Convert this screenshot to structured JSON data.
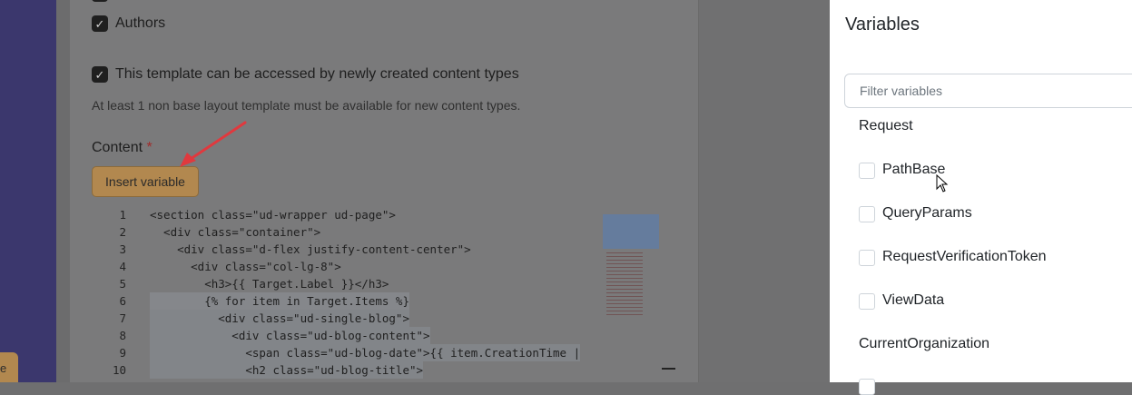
{
  "app": {
    "checkbox_check": "✓",
    "authors_label": "Authors",
    "accessible_label": "This template can be accessed by newly created content types",
    "hint": "At least 1 non base layout template must be available for new content types.",
    "content_label": "Content",
    "required_mark": "*",
    "insert_variable_label": "Insert variable",
    "left_button_fragment": "e"
  },
  "editor": {
    "line_numbers": [
      "1",
      "2",
      "3",
      "4",
      "5",
      "6",
      "7",
      "8",
      "9",
      "10"
    ],
    "lines": [
      "<section class=\"ud-wrapper ud-page\">",
      "  <div class=\"container\">",
      "    <div class=\"d-flex justify-content-center\">",
      "      <div class=\"col-lg-8\">",
      "        <h3>{{ Target.Label }}</h3>",
      "        {% for item in Target.Items %}",
      "          <div class=\"ud-single-blog\">",
      "            <div class=\"ud-blog-content\">",
      "              <span class=\"ud-blog-date\">{{ item.CreationTime |",
      "              <h2 class=\"ud-blog-title\">"
    ]
  },
  "sidebar": {
    "title": "Variables",
    "filter_placeholder": "Filter variables",
    "groups": [
      {
        "name": "Request",
        "items": [
          "PathBase",
          "QueryParams",
          "RequestVerificationToken",
          "ViewData"
        ]
      },
      {
        "name": "CurrentOrganization",
        "items": []
      }
    ]
  },
  "colors": {
    "overlay": "#7a7a7b",
    "nav": "#3b376d",
    "button": "#b2884f",
    "arrow": "#e0393e",
    "required": "#a12a2a"
  }
}
